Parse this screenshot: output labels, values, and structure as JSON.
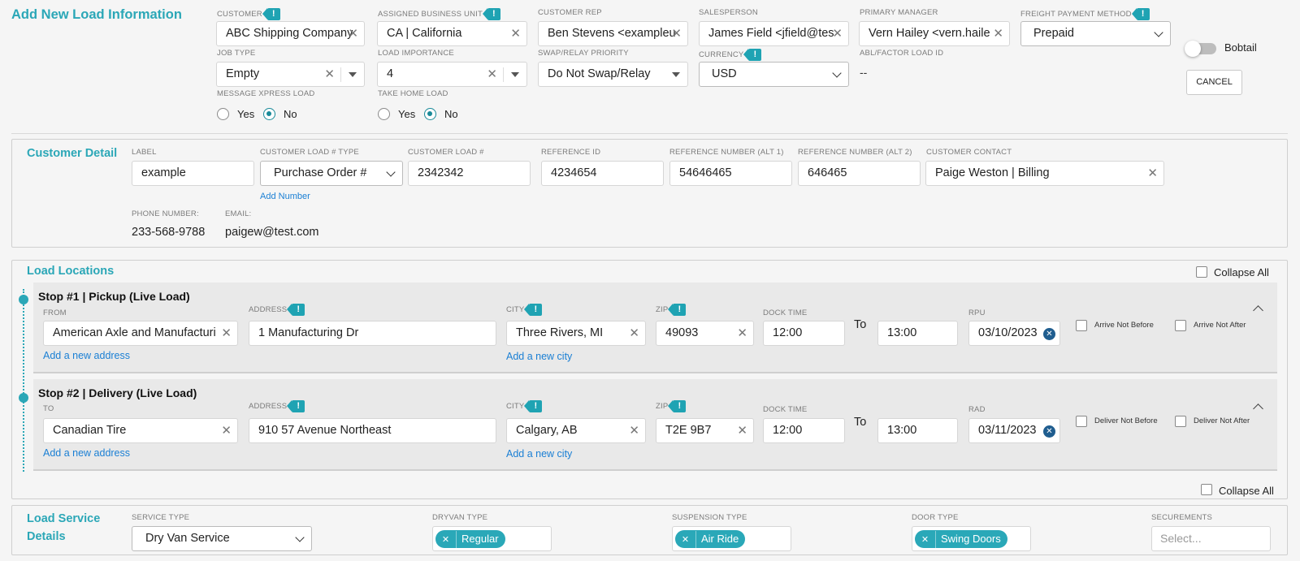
{
  "header": {
    "title": "Add New Load Information",
    "customer": {
      "label": "CUSTOMER",
      "value": "ABC Shipping Company"
    },
    "business_unit": {
      "label": "ASSIGNED BUSINESS UNIT",
      "value": "CA | California"
    },
    "customer_rep": {
      "label": "CUSTOMER REP",
      "value": "Ben Stevens <exampleu"
    },
    "salesperson": {
      "label": "SALESPERSON",
      "value": "James Field <jfield@tes"
    },
    "primary_manager": {
      "label": "PRIMARY MANAGER",
      "value": "Vern Hailey <vern.haile"
    },
    "freight_payment": {
      "label": "FREIGHT PAYMENT METHOD",
      "value": "Prepaid"
    },
    "bobtail_label": "Bobtail",
    "cancel_label": "CANCEL",
    "job_type": {
      "label": "JOB TYPE",
      "value": "Empty"
    },
    "load_importance": {
      "label": "LOAD IMPORTANCE",
      "value": "4"
    },
    "swap_priority": {
      "label": "SWAP/RELAY PRIORITY",
      "value": "Do Not Swap/Relay"
    },
    "currency": {
      "label": "CURRENCY",
      "value": "USD"
    },
    "abl_factor": {
      "label": "ABL/FACTOR LOAD ID",
      "value": "--"
    },
    "message_xpress": {
      "label": "MESSAGE XPRESS LOAD",
      "yes": "Yes",
      "no": "No",
      "selected": "No"
    },
    "take_home": {
      "label": "TAKE HOME LOAD",
      "yes": "Yes",
      "no": "No",
      "selected": "No"
    }
  },
  "customer_detail": {
    "title": "Customer Detail",
    "label": {
      "label": "LABEL",
      "value": "example"
    },
    "load_num_type": {
      "label": "CUSTOMER LOAD # TYPE",
      "value": "Purchase Order #"
    },
    "add_number": "Add Number",
    "load_num": {
      "label": "CUSTOMER LOAD #",
      "value": "2342342"
    },
    "reference_id": {
      "label": "REFERENCE ID",
      "value": "4234654"
    },
    "ref_alt1": {
      "label": "REFERENCE NUMBER (ALT 1)",
      "value": "54646465"
    },
    "ref_alt2": {
      "label": "REFERENCE NUMBER (ALT 2)",
      "value": "646465"
    },
    "contact": {
      "label": "CUSTOMER CONTACT",
      "value": "Paige Weston | Billing"
    },
    "phone": {
      "label": "PHONE NUMBER:",
      "value": "233-568-9788"
    },
    "email": {
      "label": "EMAIL:",
      "value": "paigew@test.com"
    }
  },
  "load_locations": {
    "title": "Load Locations",
    "collapse_all": "Collapse All",
    "stops": [
      {
        "title": "Stop #1 | Pickup (Live Load)",
        "party_label": "FROM",
        "party": "American Axle and Manufacturi",
        "address_label": "ADDRESS",
        "address": "1 Manufacturing Dr",
        "add_address": "Add a new address",
        "city_label": "CITY",
        "city": "Three Rivers, MI",
        "add_city": "Add a new city",
        "zip_label": "ZIP",
        "zip": "49093",
        "dock_label": "DOCK TIME",
        "dock_from": "12:00",
        "to": "To",
        "dock_to": "13:00",
        "date_label": "RPU",
        "date": "03/10/2023",
        "check1": "Arrive Not Before",
        "check2": "Arrive Not After"
      },
      {
        "title": "Stop #2 | Delivery (Live Load)",
        "party_label": "TO",
        "party": "Canadian Tire",
        "address_label": "ADDRESS",
        "address": "910 57 Avenue Northeast",
        "add_address": "Add a new address",
        "city_label": "CITY",
        "city": "Calgary, AB",
        "add_city": "Add a new city",
        "zip_label": "ZIP",
        "zip": "T2E 9B7",
        "dock_label": "DOCK TIME",
        "dock_from": "12:00",
        "to": "To",
        "dock_to": "13:00",
        "date_label": "RAD",
        "date": "03/11/2023",
        "check1": "Deliver Not Before",
        "check2": "Deliver Not After"
      }
    ],
    "collapse_all_bottom": "Collapse All"
  },
  "service": {
    "title_line1": "Load Service",
    "title_line2": "Details",
    "service_type": {
      "label": "SERVICE TYPE",
      "value": "Dry Van Service"
    },
    "dryvan_type": {
      "label": "DRYVAN TYPE",
      "value": "Regular"
    },
    "suspension_type": {
      "label": "SUSPENSION TYPE",
      "value": "Air Ride"
    },
    "door_type": {
      "label": "DOOR TYPE",
      "value": "Swing Doors"
    },
    "securements": {
      "label": "SECUREMENTS",
      "placeholder": "Select..."
    }
  },
  "colors": {
    "accent": "#2ba7b7",
    "link": "#1a7fd4",
    "badge": "#1fa3b3"
  }
}
